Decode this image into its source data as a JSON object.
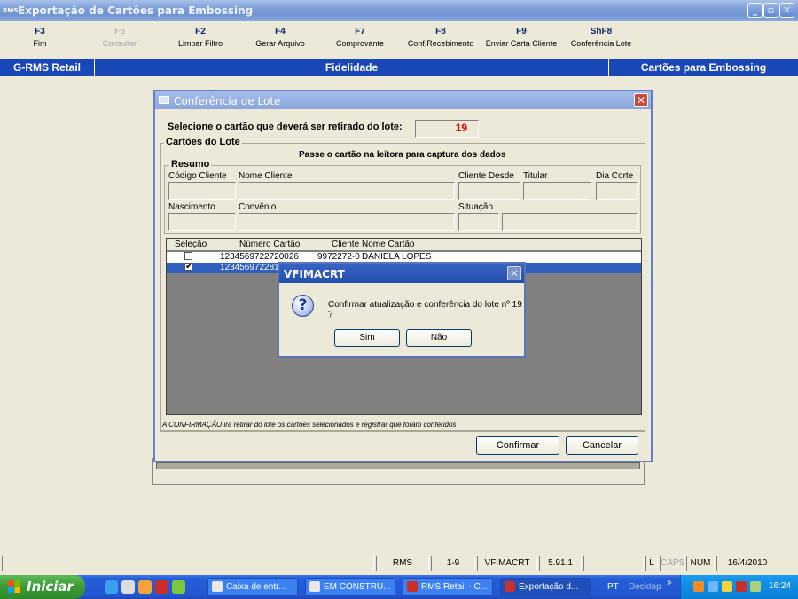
{
  "window": {
    "app_icon": "RMS",
    "title": "Exportação de Cartões para Embossing"
  },
  "fkeys": [
    {
      "key": "F3",
      "label": "Fim",
      "enabled": true
    },
    {
      "key": "F6",
      "label": "Consultar",
      "enabled": false
    },
    {
      "key": "F2",
      "label": "Limpar Filtro",
      "enabled": true
    },
    {
      "key": "F4",
      "label": "Gerar Arquivo",
      "enabled": true
    },
    {
      "key": "F7",
      "label": "Comprovante",
      "enabled": true
    },
    {
      "key": "F8",
      "label": "Conf.Recebimento",
      "enabled": true
    },
    {
      "key": "F9",
      "label": "Enviar Carta Cliente",
      "enabled": true
    },
    {
      "key": "ShF8",
      "label": "Conferência Lote",
      "enabled": true
    }
  ],
  "band": {
    "left": "G-RMS Retail",
    "center": "Fidelidade",
    "right": "Cartões para Embossing"
  },
  "dialog": {
    "title": "Conferência de Lote",
    "select_prompt": "Selecione o cartão que deverá ser retirado do lote:",
    "select_value": "19",
    "cards_group": "Cartões do Lote",
    "reader_hint": "Passe o cartão na leitora para captura dos dados",
    "summary_group": "Resumo",
    "labels": {
      "codigo_cliente": "Código Cliente",
      "nome_cliente": "Nome Cliente",
      "cliente_desde": "Cliente Desde",
      "titular": "Titular",
      "dia_corte": "Dia Corte",
      "nascimento": "Nascimento",
      "convenio": "Convênio",
      "situacao": "Situação"
    },
    "grid": {
      "columns": [
        "Seleção",
        "Número Cartão",
        "Cliente",
        "Nome Cartão"
      ],
      "rows": [
        {
          "selected": false,
          "card": "1234569722720026",
          "client": "9972272-0",
          "name": "DANIELA LOPES"
        },
        {
          "selected": true,
          "card": "12345697228100",
          "client": "",
          "name": ""
        }
      ]
    },
    "footnote": "A CONFIRMAÇÃO irá retirar do lote os cartões selecionados e registrar que foram conferidos",
    "confirm_label": "Confirmar",
    "cancel_label": "Cancelar"
  },
  "messagebox": {
    "title": "VFIMACRT",
    "text": "Confirmar atualização e conferência do lote nº 19 ?",
    "yes": "Sim",
    "no": "Não"
  },
  "statusbar": {
    "system": "RMS",
    "range": "1-9",
    "program": "VFIMACRT",
    "version": "5.91.1",
    "l": "L",
    "caps": "CAPS",
    "num": "NUM",
    "date": "16/4/2010"
  },
  "taskbar": {
    "start_label": "Iniciar",
    "tasks": [
      "Caixa de entr...",
      "EM CONSTRU...",
      "RMS Retail - C...",
      "Exportação d..."
    ],
    "lang": "PT",
    "desktop": "Desktop",
    "clock": "16:24"
  },
  "colors": {
    "band": "#1a47b8",
    "selected_row": "#2f5fbf",
    "red_value": "#e00000"
  }
}
